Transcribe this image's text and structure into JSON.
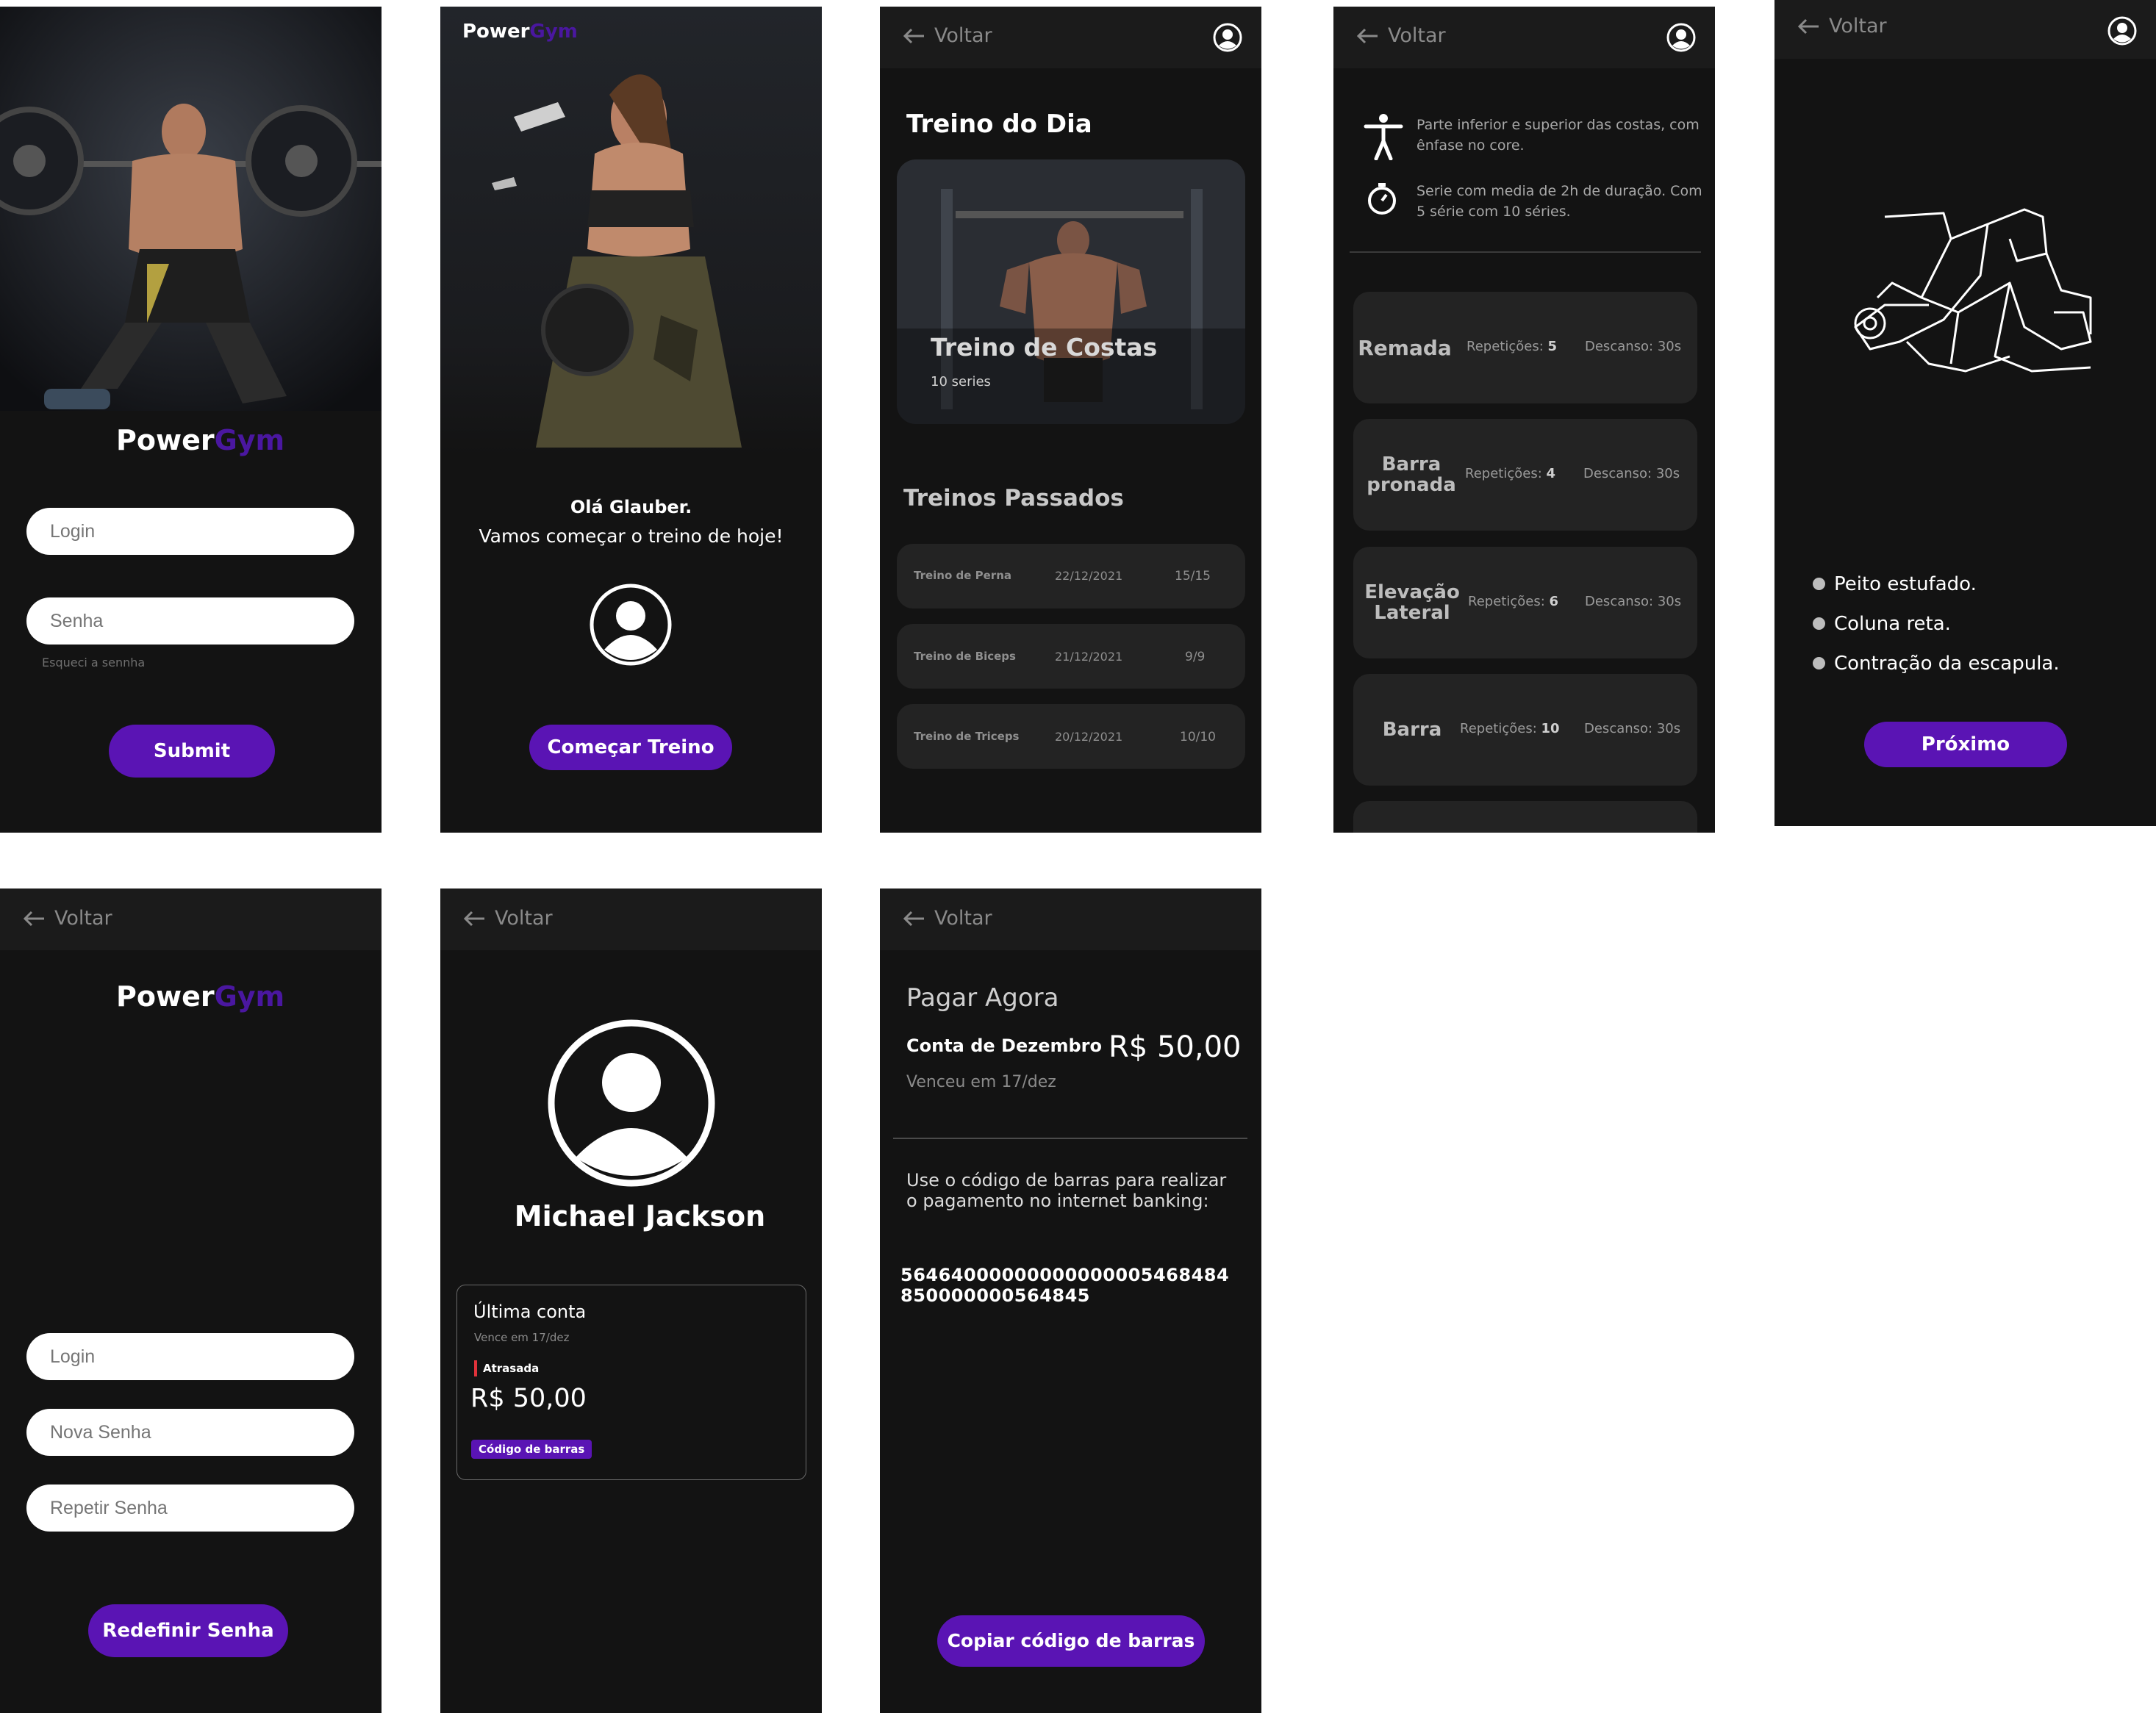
{
  "brand": {
    "power": "Power",
    "gym": "Gym"
  },
  "colors": {
    "background": "#131313",
    "topbar": "#1b1b1b",
    "card": "#232323",
    "accent": "#5a14b4",
    "accent_dark": "#4a17a0"
  },
  "common": {
    "back_label": "Voltar"
  },
  "login": {
    "login_placeholder": "Login",
    "password_placeholder": "Senha",
    "forgot_link": "Esqueci a sennha",
    "submit_label": "Submit"
  },
  "welcome": {
    "greeting": "Olá Glauber.",
    "subtitle": "Vamos começar o treino de hoje!",
    "start_button": "Começar Treino"
  },
  "workouts": {
    "today_title": "Treino do Dia",
    "today_card_title": "Treino de Costas",
    "today_card_subtitle": "10 series",
    "past_title": "Treinos Passados",
    "past": [
      {
        "name": "Treino de Perna",
        "date": "22/12/2021",
        "progress": "15/15"
      },
      {
        "name": "Treino de Biceps",
        "date": "21/12/2021",
        "progress": "9/9"
      },
      {
        "name": "Treino de Triceps",
        "date": "20/12/2021",
        "progress": "10/10"
      }
    ]
  },
  "workout_detail": {
    "info_body": "Parte inferior e superior das costas, com ênfase no core.",
    "info_time": "Serie com media de 2h de duração. Com 5 série com 10 séries.",
    "exercises": [
      {
        "name": "Remada",
        "reps_label": "Repetições:",
        "reps": "5",
        "rest": "Descanso: 30s"
      },
      {
        "name": "Barra pronada",
        "reps_label": "Repetições:",
        "reps": "4",
        "rest": "Descanso: 30s"
      },
      {
        "name": "Elevação Lateral",
        "reps_label": "Repetições:",
        "reps": "6",
        "rest": "Descanso: 30s"
      },
      {
        "name": "Barra",
        "reps_label": "Repetições:",
        "reps": "10",
        "rest": "Descanso: 30s"
      }
    ]
  },
  "exercise": {
    "tips": [
      "Peito estufado.",
      "Coluna reta.",
      "Contração da escapula."
    ],
    "next_button": "Próximo"
  },
  "reset": {
    "login_placeholder": "Login",
    "new_password_placeholder": "Nova Senha",
    "repeat_password_placeholder": "Repetir Senha",
    "submit_label": "Redefinir Senha"
  },
  "profile": {
    "name": "Michael Jackson",
    "bill_title": "Última conta",
    "bill_due": "Vence em 17/dez",
    "bill_status": "Atrasada",
    "bill_amount": "R$ 50,00",
    "barcode_button": "Código de barras"
  },
  "payment": {
    "title": "Pagar Agora",
    "bill_name": "Conta de Dezembro",
    "amount": "R$ 50,00",
    "due": "Venceu em 17/dez",
    "instructions": "Use o código de barras para realizar o pagamento no internet banking:",
    "barcode_line1": "56464000000000000005468484",
    "barcode_line2": "850000000564845",
    "copy_button": "Copiar código de barras"
  }
}
